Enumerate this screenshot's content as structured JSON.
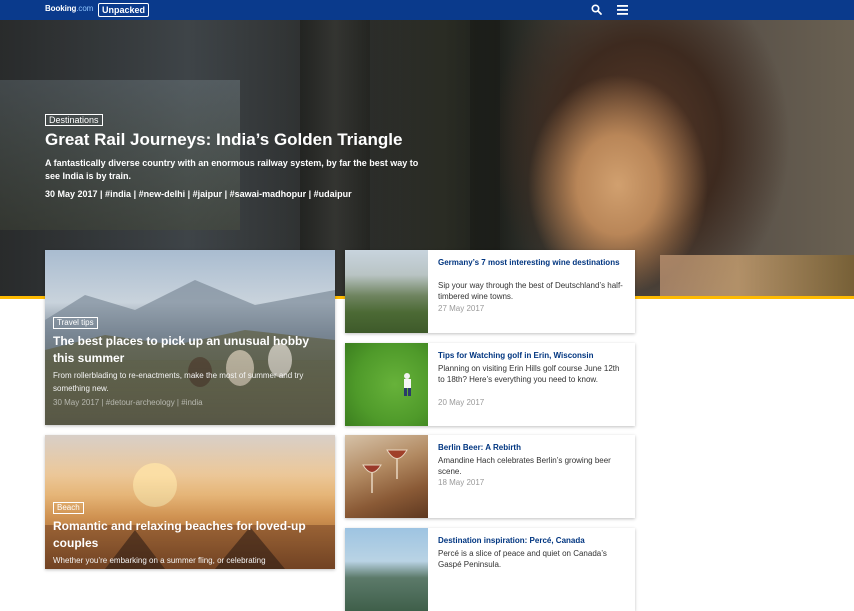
{
  "header": {
    "brand_main": "Booking",
    "brand_suffix": ".com",
    "section": "Unpacked",
    "search_icon": "search-icon",
    "menu_icon": "hamburger-menu-icon",
    "background_color": "#0a3a8c",
    "accent_color": "#febb02"
  },
  "hero": {
    "tag": "Destinations",
    "title": "Great Rail Journeys: India’s Golden Triangle",
    "description": "A fantastically diverse country with an enormous railway system, by far the best way to see India is by train.",
    "meta": "30 May 2017 | #india | #new-delhi | #jaipur | #sawai-madhopur | #udaipur"
  },
  "feature_cards": [
    {
      "tag": "Travel tips",
      "title": "The best places to pick up an unusual hobby this summer",
      "description": "From rollerblading to re-enactments, make the most of summer and try something new.",
      "meta": "30 May 2017 | #detour-archeology | #india"
    },
    {
      "tag": "Beach",
      "title": "Romantic and relaxing beaches for loved-up couples",
      "description": "Whether you’re embarking on a summer fling, or celebrating"
    }
  ],
  "articles": [
    {
      "title": "Germany’s 7 most interesting wine destinations",
      "description": "Sip your way through the best of Deutschland’s half-timbered wine towns.",
      "date": "27 May 2017"
    },
    {
      "title": "Tips for Watching golf in Erin, Wisconsin",
      "description": "Planning on visiting Erin Hills golf course June 12th to 18th? Here’s everything you need to know.",
      "date": "20 May 2017"
    },
    {
      "title": "Berlin Beer: A Rebirth",
      "description": "Amandine Hach celebrates Berlin’s growing beer scene.",
      "date": "18 May 2017"
    },
    {
      "title": "Destination inspiration: Percé, Canada",
      "description": "Percé is a slice of peace and quiet on Canada’s Gaspé Peninsula."
    }
  ]
}
